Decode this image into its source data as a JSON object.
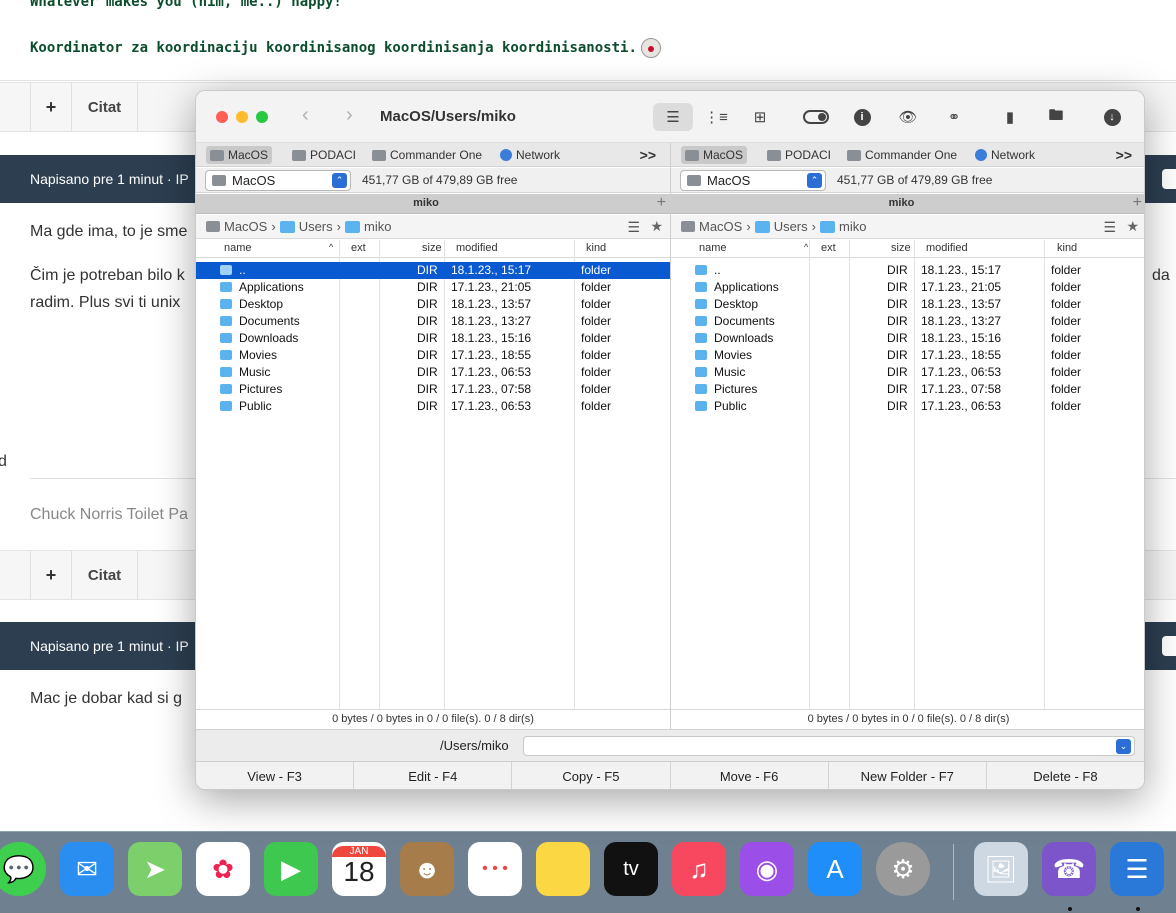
{
  "forum": {
    "signature_line1": "Whatever makes you (him, me..) happy!",
    "signature_line2": "Koordinator za koordinaciju koordinisanog koordinisanja koordinisanosti.",
    "toolbar": {
      "plus_label": "+",
      "quote_label": "Citat"
    },
    "posts": [
      {
        "header": "Napisano pre 1 minut · IP",
        "text1": "Ma gde ima, to je sme",
        "text2": "Čim je potreban bilo k",
        "text3": "radim. Plus svi ti unix",
        "trailing": "da",
        "signature": "Chuck Norris Toilet Pa"
      },
      {
        "header": "Napisano pre 1 minut · IP",
        "text1": "Mac je dobar kad si g"
      }
    ],
    "left_edge_char": "d"
  },
  "window": {
    "title": "MacOS/Users/miko",
    "back_icon": "chevron-left-icon",
    "forward_icon": "chevron-right-icon",
    "toolbar_icons": [
      "list-view-icon",
      "detailed-list-icon",
      "grid-view-icon",
      "toggle-hidden-icon",
      "info-icon",
      "preview-icon",
      "find-icon",
      "archive-icon",
      "network-drive-icon",
      "download-icon"
    ],
    "panels": [
      {
        "tabs": [
          "MacOS",
          "PODACI",
          "Commander One",
          "Network"
        ],
        "tabs_more": ">>",
        "drive": "MacOS",
        "free_space": "451,77 GB of 479,89 GB free",
        "tab_title": "miko",
        "breadcrumb": [
          "MacOS",
          "Users",
          "miko"
        ],
        "columns": {
          "name": "name",
          "ext": "ext",
          "size": "size",
          "modified": "modified",
          "kind": "kind"
        },
        "rows": [
          {
            "name": "..",
            "size": "DIR",
            "modified": "18.1.23., 15:17",
            "kind": "folder",
            "selected": true
          },
          {
            "name": "Applications",
            "size": "DIR",
            "modified": "17.1.23., 21:05",
            "kind": "folder"
          },
          {
            "name": "Desktop",
            "size": "DIR",
            "modified": "18.1.23., 13:57",
            "kind": "folder"
          },
          {
            "name": "Documents",
            "size": "DIR",
            "modified": "18.1.23., 13:27",
            "kind": "folder"
          },
          {
            "name": "Downloads",
            "size": "DIR",
            "modified": "18.1.23., 15:16",
            "kind": "folder"
          },
          {
            "name": "Movies",
            "size": "DIR",
            "modified": "17.1.23., 18:55",
            "kind": "folder"
          },
          {
            "name": "Music",
            "size": "DIR",
            "modified": "17.1.23., 06:53",
            "kind": "folder"
          },
          {
            "name": "Pictures",
            "size": "DIR",
            "modified": "17.1.23., 07:58",
            "kind": "folder"
          },
          {
            "name": "Public",
            "size": "DIR",
            "modified": "17.1.23., 06:53",
            "kind": "folder"
          }
        ],
        "status": "0 bytes / 0 bytes in 0 / 0 file(s). 0 / 8 dir(s)"
      },
      {
        "tabs": [
          "MacOS",
          "PODACI",
          "Commander One",
          "Network"
        ],
        "tabs_more": ">>",
        "drive": "MacOS",
        "free_space": "451,77 GB of 479,89 GB free",
        "tab_title": "miko",
        "breadcrumb": [
          "MacOS",
          "Users",
          "miko"
        ],
        "columns": {
          "name": "name",
          "ext": "ext",
          "size": "size",
          "modified": "modified",
          "kind": "kind"
        },
        "rows": [
          {
            "name": "..",
            "size": "DIR",
            "modified": "18.1.23., 15:17",
            "kind": "folder"
          },
          {
            "name": "Applications",
            "size": "DIR",
            "modified": "17.1.23., 21:05",
            "kind": "folder"
          },
          {
            "name": "Desktop",
            "size": "DIR",
            "modified": "18.1.23., 13:57",
            "kind": "folder"
          },
          {
            "name": "Documents",
            "size": "DIR",
            "modified": "18.1.23., 13:27",
            "kind": "folder"
          },
          {
            "name": "Downloads",
            "size": "DIR",
            "modified": "18.1.23., 15:16",
            "kind": "folder"
          },
          {
            "name": "Movies",
            "size": "DIR",
            "modified": "17.1.23., 18:55",
            "kind": "folder"
          },
          {
            "name": "Music",
            "size": "DIR",
            "modified": "17.1.23., 06:53",
            "kind": "folder"
          },
          {
            "name": "Pictures",
            "size": "DIR",
            "modified": "17.1.23., 07:58",
            "kind": "folder"
          },
          {
            "name": "Public",
            "size": "DIR",
            "modified": "17.1.23., 06:53",
            "kind": "folder"
          }
        ],
        "status": "0 bytes / 0 bytes in 0 / 0 file(s). 0 / 8 dir(s)"
      }
    ],
    "command_path": "/Users/miko",
    "command_value": "",
    "function_keys": [
      "View - F3",
      "Edit - F4",
      "Copy - F5",
      "Move - F6",
      "New Folder - F7",
      "Delete - F8"
    ]
  },
  "dock": {
    "calendar_month": "JAN",
    "calendar_day": "18",
    "apps": [
      "messages-icon",
      "mail-icon",
      "maps-icon",
      "photos-icon",
      "facetime-icon",
      "calendar-icon",
      "contacts-icon",
      "reminders-icon",
      "notes-icon",
      "apple-tv-icon",
      "music-icon",
      "podcasts-icon",
      "app-store-icon",
      "system-preferences-icon",
      "preview-icon",
      "viber-icon",
      "commander-one-icon"
    ]
  }
}
